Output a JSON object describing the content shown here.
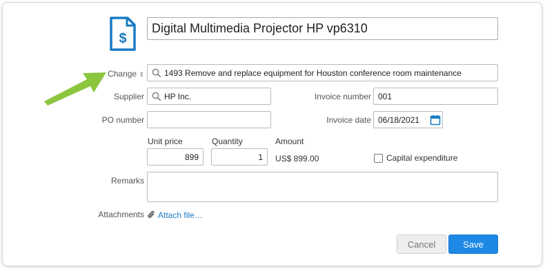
{
  "title": "Digital Multimedia Projector HP vp6310",
  "icon": "invoice-dollar-icon",
  "change": {
    "label": "Change",
    "value": "1493  Remove and replace equipment for Houston conference room maintenance"
  },
  "supplier": {
    "label": "Supplier",
    "value": "HP Inc."
  },
  "invoice_number": {
    "label": "Invoice number",
    "value": "001"
  },
  "po_number": {
    "label": "PO number",
    "value": ""
  },
  "invoice_date": {
    "label": "Invoice date",
    "value": "06/18/2021"
  },
  "unit_price": {
    "label": "Unit price",
    "value": "899"
  },
  "quantity": {
    "label": "Quantity",
    "value": "1"
  },
  "amount": {
    "label": "Amount",
    "value": "US$ 899.00"
  },
  "capital_expenditure": {
    "label": "Capital expenditure",
    "checked": false
  },
  "remarks": {
    "label": "Remarks",
    "value": ""
  },
  "attachments": {
    "label": "Attachments",
    "link": "Attach file…"
  },
  "buttons": {
    "cancel": "Cancel",
    "save": "Save"
  },
  "colors": {
    "accent": "#1e88e5",
    "link": "#1a7bc4",
    "arrow": "#8cc63f"
  }
}
